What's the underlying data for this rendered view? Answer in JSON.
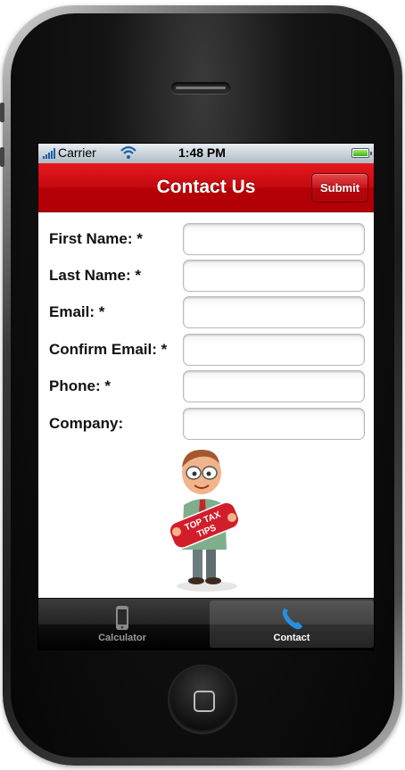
{
  "status_bar": {
    "carrier": "Carrier",
    "time": "1:48 PM"
  },
  "navbar": {
    "title": "Contact Us",
    "submit_label": "Submit"
  },
  "form": {
    "fields": [
      {
        "label": "First Name: *",
        "value": ""
      },
      {
        "label": "Last Name: *",
        "value": ""
      },
      {
        "label": "Email: *",
        "value": ""
      },
      {
        "label": "Confirm Email: *",
        "value": ""
      },
      {
        "label": "Phone: *",
        "value": ""
      },
      {
        "label": "Company:",
        "value": ""
      }
    ]
  },
  "mascot": {
    "banner_text_line1": "TOP TAX",
    "banner_text_line2": "TIPS"
  },
  "tab_bar": {
    "tabs": [
      {
        "label": "Calculator",
        "icon": "phone-device-icon",
        "selected": false
      },
      {
        "label": "Contact",
        "icon": "phone-handset-icon",
        "selected": true
      }
    ]
  },
  "colors": {
    "navbar_red": "#c3090f",
    "battery_green": "#3dae18",
    "selected_tab_icon": "#2a8ee0"
  }
}
